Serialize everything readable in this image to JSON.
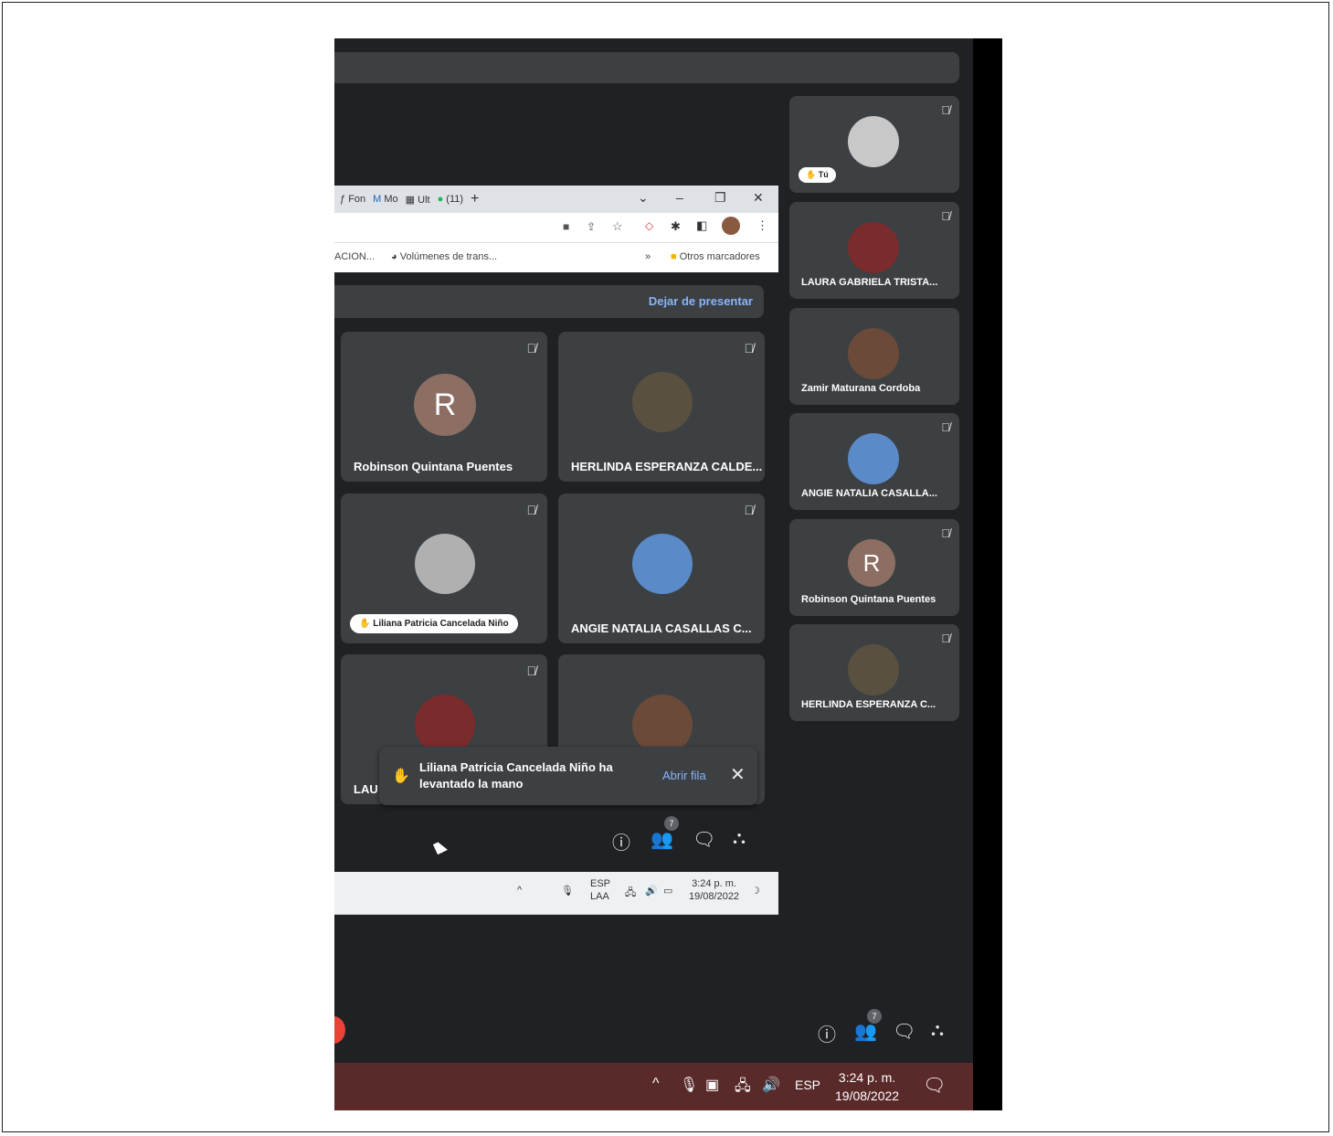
{
  "right_strip": [
    {
      "name": "",
      "self_label": "Tú",
      "avatar_color": "#c8c8c8"
    },
    {
      "name": "LAURA GABRIELA TRISTA...",
      "avatar_color": "#7a2b2b"
    },
    {
      "name": "Zamir Maturana Cordoba",
      "avatar_color": "#6b4a3a"
    },
    {
      "name": "ANGIE NATALIA CASALLA...",
      "avatar_color": "#5a8ac8"
    },
    {
      "name": "Robinson Quintana Puentes",
      "initial": "R"
    },
    {
      "name": "HERLINDA ESPERANZA C...",
      "avatar_color": "#5a5040"
    }
  ],
  "browser": {
    "tabs": [
      "Fon",
      "Mo",
      "Ult",
      "(11)"
    ],
    "new_tab": "+",
    "bookmarks": [
      "ACION...",
      "Volúmenes de trans...",
      "Otros marcadores"
    ]
  },
  "presenting": {
    "stop_label": "Dejar de presentar"
  },
  "grid": [
    {
      "name": "Robinson Quintana Puentes",
      "initial": "R"
    },
    {
      "name": "HERLINDA ESPERANZA CALDE...",
      "avatar_color": "#5a5040"
    },
    {
      "name": "Liliana Patricia Cancelada Niño",
      "hand_raised": true,
      "avatar_color": "#b0b0b0"
    },
    {
      "name": "ANGIE NATALIA CASALLAS C...",
      "avatar_color": "#5a8ac8"
    },
    {
      "name": "LAU",
      "avatar_color": "#7a2b2b"
    },
    {
      "name": "",
      "avatar_color": "#6b4a3a"
    }
  ],
  "toast": {
    "message": "Liliana Patricia Cancelada Niño ha levantado la mano",
    "action": "Abrir fila"
  },
  "controls": {
    "participants_count": "7"
  },
  "inner_taskbar": {
    "lang": "ESP",
    "lang2": "LAA",
    "time": "3:24 p. m.",
    "date": "19/08/2022"
  },
  "taskbar": {
    "lang": "ESP",
    "time": "3:24 p. m.",
    "date": "19/08/2022"
  }
}
